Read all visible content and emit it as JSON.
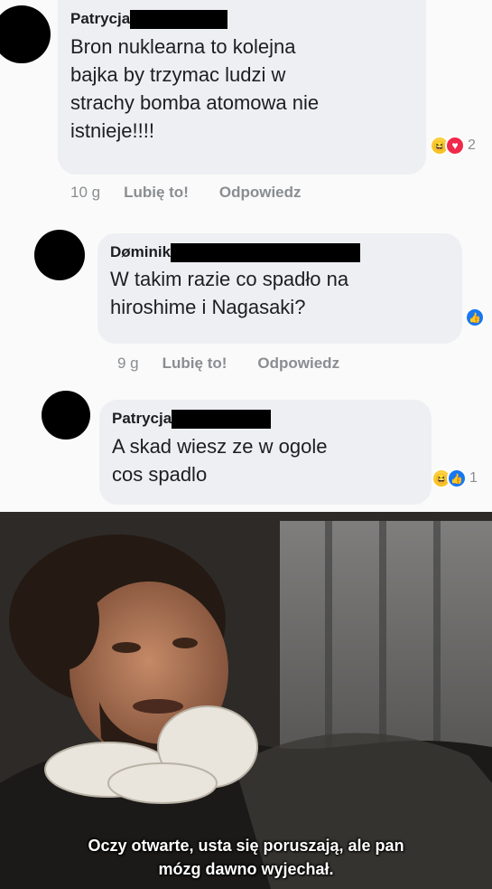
{
  "comments": [
    {
      "author": "Patrycja",
      "text": "Bron nuklearna to kolejna\nbajka by trzymac ludzi w\nstrachy bomba atomowa nie\nistnieje!!!!",
      "time": "10 g",
      "like_label": "Lubię to!",
      "reply_label": "Odpowiedz",
      "reactions": [
        "laugh-emoji",
        "heart-emoji"
      ],
      "reaction_count": "2"
    },
    {
      "author": "Døminik",
      "text": "W takim razie co spadło na\nhiroshime i Nagasaki?",
      "time": "9 g",
      "like_label": "Lubię to!",
      "reply_label": "Odpowiedz",
      "reactions": [
        "like-emoji"
      ],
      "reaction_count": ""
    },
    {
      "author": "Patrycja",
      "text": "A skad wiesz ze w ogole\ncos spadlo",
      "reactions": [
        "laugh-emoji",
        "like-emoji"
      ],
      "reaction_count": "1"
    }
  ],
  "meme": {
    "subtitle_line1": "Oczy otwarte, usta się poruszają, ale pan",
    "subtitle_line2": "mózg dawno wyjechał."
  }
}
